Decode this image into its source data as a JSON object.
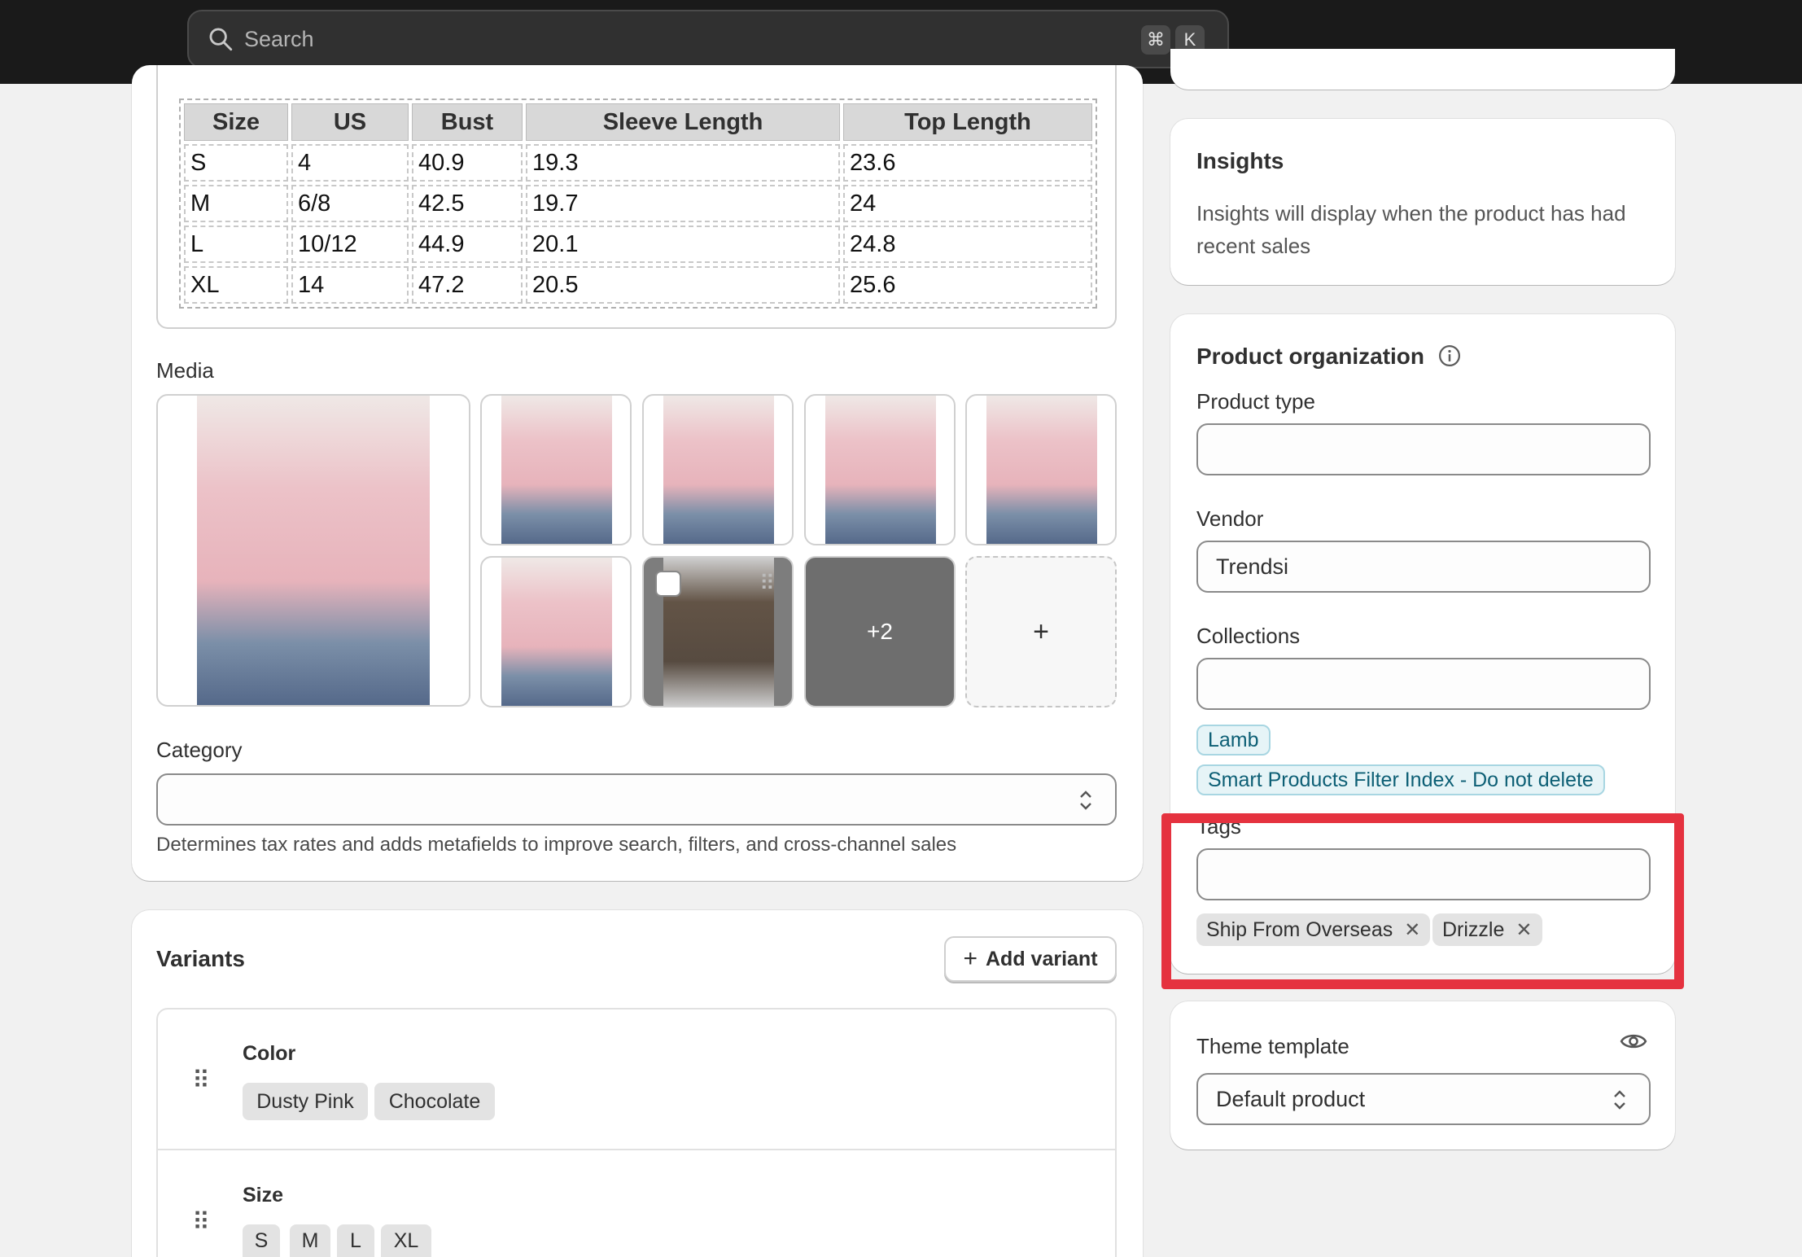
{
  "search": {
    "placeholder": "Search",
    "shortcut_cmd": "⌘",
    "shortcut_key": "K"
  },
  "size_chart": {
    "headers": [
      "Size",
      "US",
      "Bust",
      "Sleeve Length",
      "Top Length"
    ],
    "rows": [
      [
        "S",
        "4",
        "40.9",
        "19.3",
        "23.6"
      ],
      [
        "M",
        "6/8",
        "42.5",
        "19.7",
        "24"
      ],
      [
        "L",
        "10/12",
        "44.9",
        "20.1",
        "24.8"
      ],
      [
        "XL",
        "14",
        "47.2",
        "20.5",
        "25.6"
      ]
    ]
  },
  "media": {
    "label": "Media",
    "more_count": "+2",
    "add_label": "+"
  },
  "category": {
    "label": "Category",
    "value": "",
    "help": "Determines tax rates and adds metafields to improve search, filters, and cross-channel sales"
  },
  "variants": {
    "title": "Variants",
    "add_label": "Add variant",
    "options": [
      {
        "name": "Color",
        "values": [
          "Dusty Pink",
          "Chocolate"
        ]
      },
      {
        "name": "Size",
        "values": [
          "S",
          "M",
          "L",
          "XL"
        ]
      }
    ]
  },
  "insights": {
    "title": "Insights",
    "body": "Insights will display when the product has had recent sales"
  },
  "product_org": {
    "title": "Product organization",
    "product_type_label": "Product type",
    "product_type_value": "",
    "vendor_label": "Vendor",
    "vendor_value": "Trendsi",
    "collections_label": "Collections",
    "collections": [
      "Lamb",
      "Smart Products Filter Index - Do not delete"
    ],
    "tags_label": "Tags",
    "tags": [
      "Ship From Overseas",
      "Drizzle"
    ]
  },
  "theme_template": {
    "label": "Theme template",
    "value": "Default product"
  },
  "colors": {
    "highlight": "#e5323f",
    "topbar": "#1a1a1a",
    "collection_chip": "#e6f4f7",
    "collection_text": "#0d5f75"
  }
}
